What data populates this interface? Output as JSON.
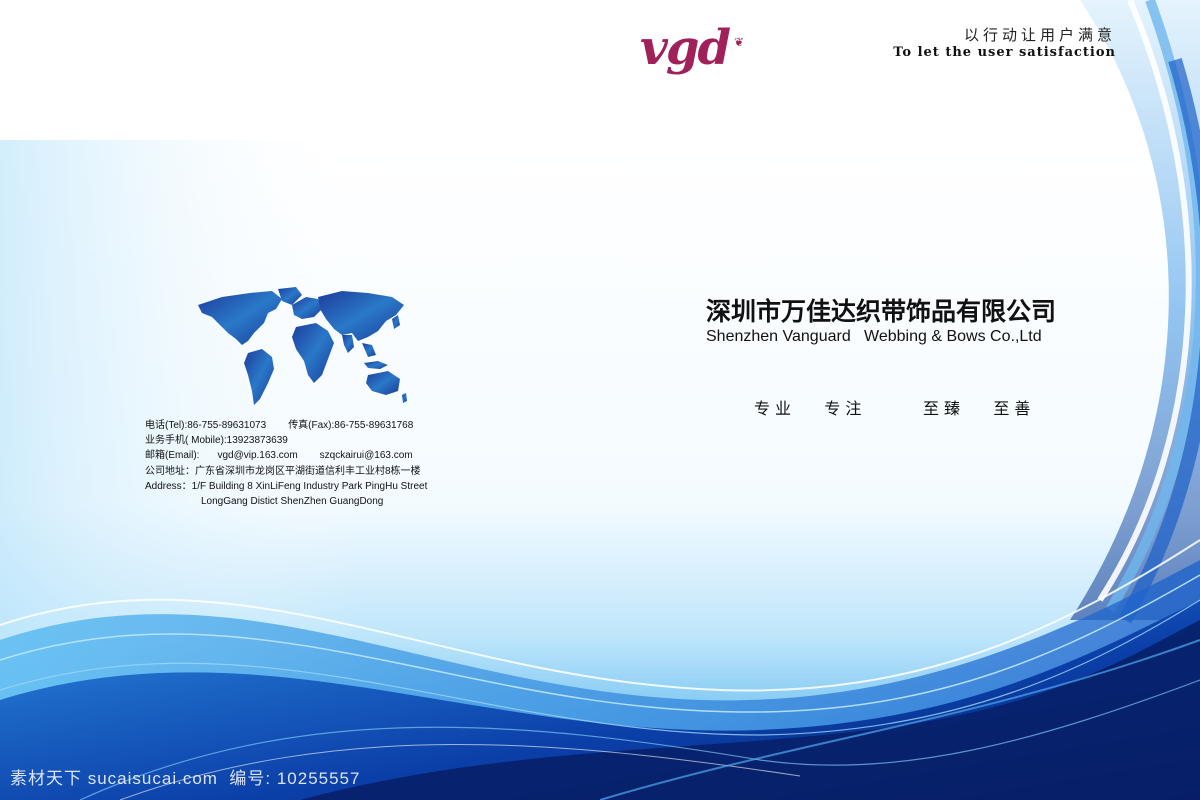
{
  "header": {
    "slogan_cn": "以行动让用户满意",
    "slogan_en": "To let the user satisfaction",
    "logo_text": "vgd"
  },
  "company": {
    "name_cn": "深圳市万佳达织带饰品有限公司",
    "name_en": "Shenzhen Vanguard   Webbing & Bows Co.,Ltd",
    "values": [
      "专业",
      "专注",
      "至臻",
      "至善"
    ]
  },
  "contact": {
    "tel": "电话(Tel):86-755-89631073",
    "fax": "传真(Fax):86-755-89631768",
    "mobile": "业务手机( Mobile):13923873639",
    "email_label": "邮箱(Email):",
    "email_1": "vgd@vip.163.com",
    "email_2": "szqckairui@163.com",
    "address_cn": "公司地址：广东省深圳市龙岗区平湖街道信利丰工业村8栋一楼",
    "address_en_1": "Address：1/F Building 8 XinLiFeng Industry Park PingHu Street",
    "address_en_2": "LongGang Distict ShenZhen GuangDong"
  },
  "watermark": {
    "text": "素材天下 sucaisucai.com  编号: 10255557"
  },
  "colors": {
    "logo": "#a0205a",
    "wave_dark": "#0a2f8a",
    "wave_mid": "#1f6fd0",
    "wave_light": "#8fd0f5"
  }
}
